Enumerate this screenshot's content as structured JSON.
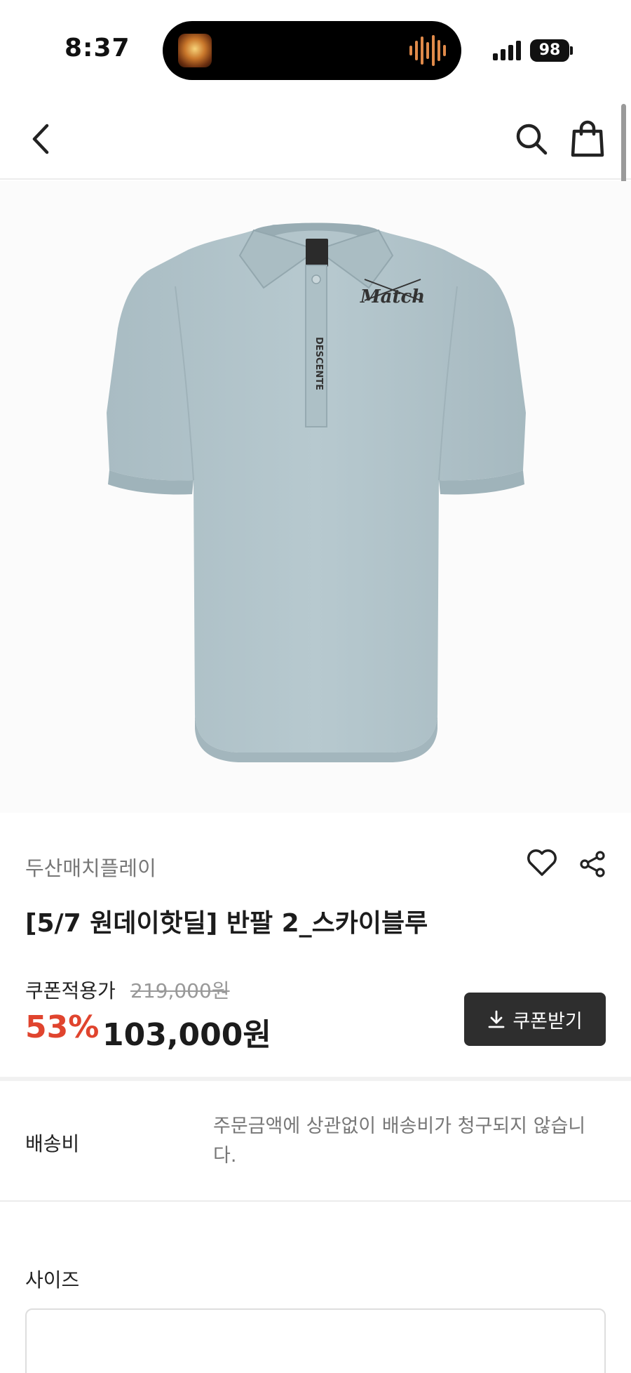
{
  "status_bar": {
    "time": "8:37",
    "battery": "98"
  },
  "header": {
    "back_icon": "chevron-left-icon",
    "search_icon": "search-icon",
    "cart_icon": "shopping-bag-icon"
  },
  "product": {
    "brand": "두산매치플레이",
    "title": "[5/7 원데이핫딜] 반팔 2_스카이블루",
    "image": {
      "shirt_color": "#b4c6cc",
      "collar_logo": "DESCENTE",
      "chest_logo": "Match"
    },
    "like_icon": "heart-icon",
    "share_icon": "share-icon"
  },
  "price": {
    "label": "쿠폰적용가",
    "original": "219,000원",
    "discount": "53%",
    "final": "103,000원",
    "discount_color": "#e0442e"
  },
  "coupon_button": {
    "icon": "download-icon",
    "label": "쿠폰받기"
  },
  "shipping": {
    "label": "배송비",
    "text": "주문금액에 상관없이 배송비가 청구되지 않습니다."
  },
  "size": {
    "label": "사이즈"
  }
}
